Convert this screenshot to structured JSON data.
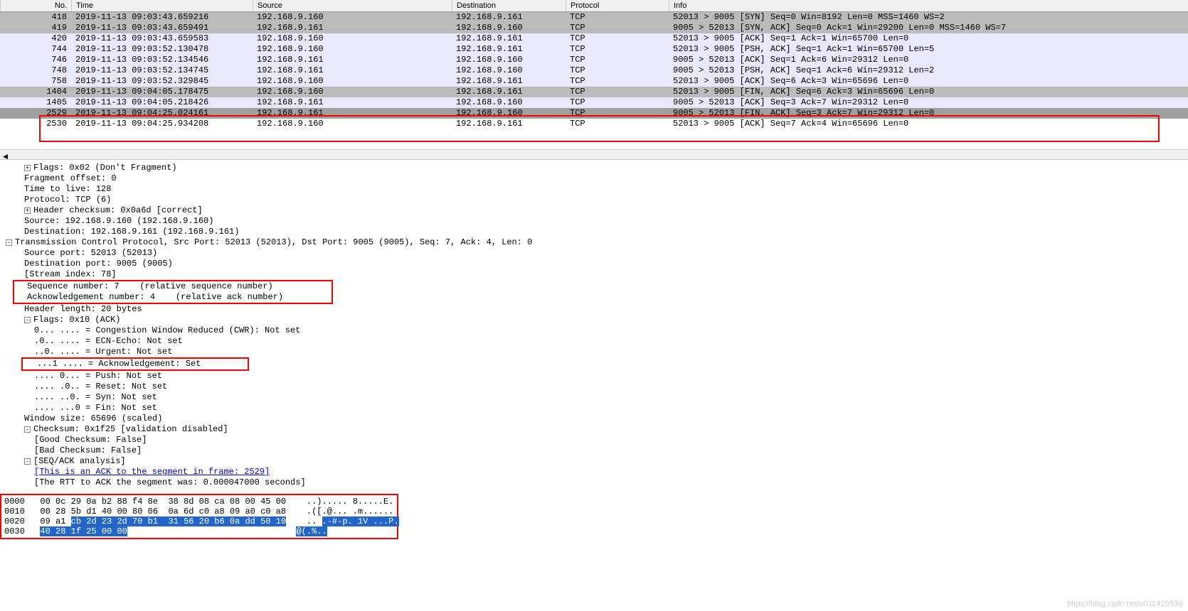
{
  "columns": {
    "no": "No.",
    "time": "Time",
    "source": "Source",
    "destination": "Destination",
    "protocol": "Protocol",
    "info": "Info"
  },
  "packets": [
    {
      "no": "418",
      "time": "2019-11-13 09:03:43.659216",
      "src": "192.168.9.160",
      "dst": "192.168.9.161",
      "proto": "TCP",
      "info": "52013 > 9005 [SYN] Seq=0 Win=8192 Len=0 MSS=1460 WS=2",
      "style": "row-gray"
    },
    {
      "no": "419",
      "time": "2019-11-13 09:03:43.659491",
      "src": "192.168.9.161",
      "dst": "192.168.9.160",
      "proto": "TCP",
      "info": "9005 > 52013 [SYN, ACK] Seq=0 Ack=1 Win=29200 Len=0 MSS=1460 WS=7",
      "style": "row-gray"
    },
    {
      "no": "420",
      "time": "2019-11-13 09:03:43.659583",
      "src": "192.168.9.160",
      "dst": "192.168.9.161",
      "proto": "TCP",
      "info": "52013 > 9005 [ACK] Seq=1 Ack=1 Win=65700 Len=0",
      "style": "row-lightpurple"
    },
    {
      "no": "744",
      "time": "2019-11-13 09:03:52.130478",
      "src": "192.168.9.160",
      "dst": "192.168.9.161",
      "proto": "TCP",
      "info": "52013 > 9005 [PSH, ACK] Seq=1 Ack=1 Win=65700 Len=5",
      "style": "row-lightpurple"
    },
    {
      "no": "746",
      "time": "2019-11-13 09:03:52.134546",
      "src": "192.168.9.161",
      "dst": "192.168.9.160",
      "proto": "TCP",
      "info": "9005 > 52013 [ACK] Seq=1 Ack=6 Win=29312 Len=0",
      "style": "row-lightpurple"
    },
    {
      "no": "748",
      "time": "2019-11-13 09:03:52.134745",
      "src": "192.168.9.161",
      "dst": "192.168.9.160",
      "proto": "TCP",
      "info": "9005 > 52013 [PSH, ACK] Seq=1 Ack=6 Win=29312 Len=2",
      "style": "row-lightpurple"
    },
    {
      "no": "758",
      "time": "2019-11-13 09:03:52.329845",
      "src": "192.168.9.160",
      "dst": "192.168.9.161",
      "proto": "TCP",
      "info": "52013 > 9005 [ACK] Seq=6 Ack=3 Win=65696 Len=0",
      "style": "row-lightpurple"
    },
    {
      "no": "1404",
      "time": "2019-11-13 09:04:05.178475",
      "src": "192.168.9.160",
      "dst": "192.168.9.161",
      "proto": "TCP",
      "info": "52013 > 9005 [FIN, ACK] Seq=6 Ack=3 Win=65696 Len=0",
      "style": "row-gray"
    },
    {
      "no": "1405",
      "time": "2019-11-13 09:04:05.218426",
      "src": "192.168.9.161",
      "dst": "192.168.9.160",
      "proto": "TCP",
      "info": "9005 > 52013 [ACK] Seq=3 Ack=7 Win=29312 Len=0",
      "style": "row-lightpurple"
    },
    {
      "no": "2529",
      "time": "2019-11-13 09:04:25.024161",
      "src": "192.168.9.161",
      "dst": "192.168.9.160",
      "proto": "TCP",
      "info": "9005 > 52013 [FIN, ACK] Seq=3 Ack=7 Win=29312 Len=0",
      "style": "row-darkgray"
    },
    {
      "no": "2530",
      "time": "2019-11-13 09:04:25.934208",
      "src": "192.168.9.160",
      "dst": "192.168.9.161",
      "proto": "TCP",
      "info": "52013 > 9005 [ACK] Seq=7 Ack=4 Win=65696 Len=0",
      "style": "row-white"
    }
  ],
  "details": {
    "flags_ip": "Flags: 0x02 (Don't Fragment)",
    "frag_offset": "Fragment offset: 0",
    "ttl": "Time to live: 128",
    "proto": "Protocol: TCP (6)",
    "hdr_checksum": "Header checksum: 0x0a6d [correct]",
    "src_ip": "Source: 192.168.9.160 (192.168.9.160)",
    "dst_ip": "Destination: 192.168.9.161 (192.168.9.161)",
    "tcp_header": "Transmission Control Protocol, Src Port: 52013 (52013), Dst Port: 9005 (9005), Seq: 7, Ack: 4, Len: 0",
    "src_port": "Source port: 52013 (52013)",
    "dst_port": "Destination port: 9005 (9005)",
    "stream_idx": "[Stream index: 78]",
    "seq_num": "Sequence number: 7    (relative sequence number)",
    "ack_num": "Acknowledgement number: 4    (relative ack number)",
    "hdr_len": "Header length: 20 bytes",
    "flags_tcp": "Flags: 0x10 (ACK)",
    "flag_cwr": "0... .... = Congestion Window Reduced (CWR): Not set",
    "flag_ecn": ".0.. .... = ECN-Echo: Not set",
    "flag_urg": "..0. .... = Urgent: Not set",
    "flag_ack": "...1 .... = Acknowledgement: Set",
    "flag_psh": ".... 0... = Push: Not set",
    "flag_rst": ".... .0.. = Reset: Not set",
    "flag_syn": ".... ..0. = Syn: Not set",
    "flag_fin": ".... ...0 = Fin: Not set",
    "win_size": "Window size: 65696 (scaled)",
    "checksum": "Checksum: 0x1f25 [validation disabled]",
    "good_cs": "[Good Checksum: False]",
    "bad_cs": "[Bad Checksum: False]",
    "seqack": "[SEQ/ACK analysis]",
    "ack_link": "[This is an ACK to the segment in frame: 2529]",
    "rtt": "[The RTT to ACK the segment was: 0.000047000 seconds]"
  },
  "hex": {
    "r0": {
      "off": "0000",
      "bytes": "00 0c 29 0a b2 88 f4 8e  38 8d 08 ca 08 00 45 00",
      "ascii": "..)..... 8.....E."
    },
    "r1": {
      "off": "0010",
      "bytes": "00 28 5b d1 40 00 80 06  0a 6d c0 a8 09 a0 c0 a8",
      "ascii": ".([.@... .m......"
    },
    "r2": {
      "off": "0020",
      "pre": "09 a1 ",
      "sel": "cb 2d 23 2d 70 b1  31 56 20 b6 0a dd 50 10",
      "ascii_pre": ".. ",
      "ascii_sel": ".-#-p. 1V ...P."
    },
    "r3": {
      "off": "0030",
      "sel": "40 28 1f 25 00 00",
      "ascii_sel": "@(.%.."
    }
  },
  "watermark": "https://blog.csdn.net/u011425939"
}
